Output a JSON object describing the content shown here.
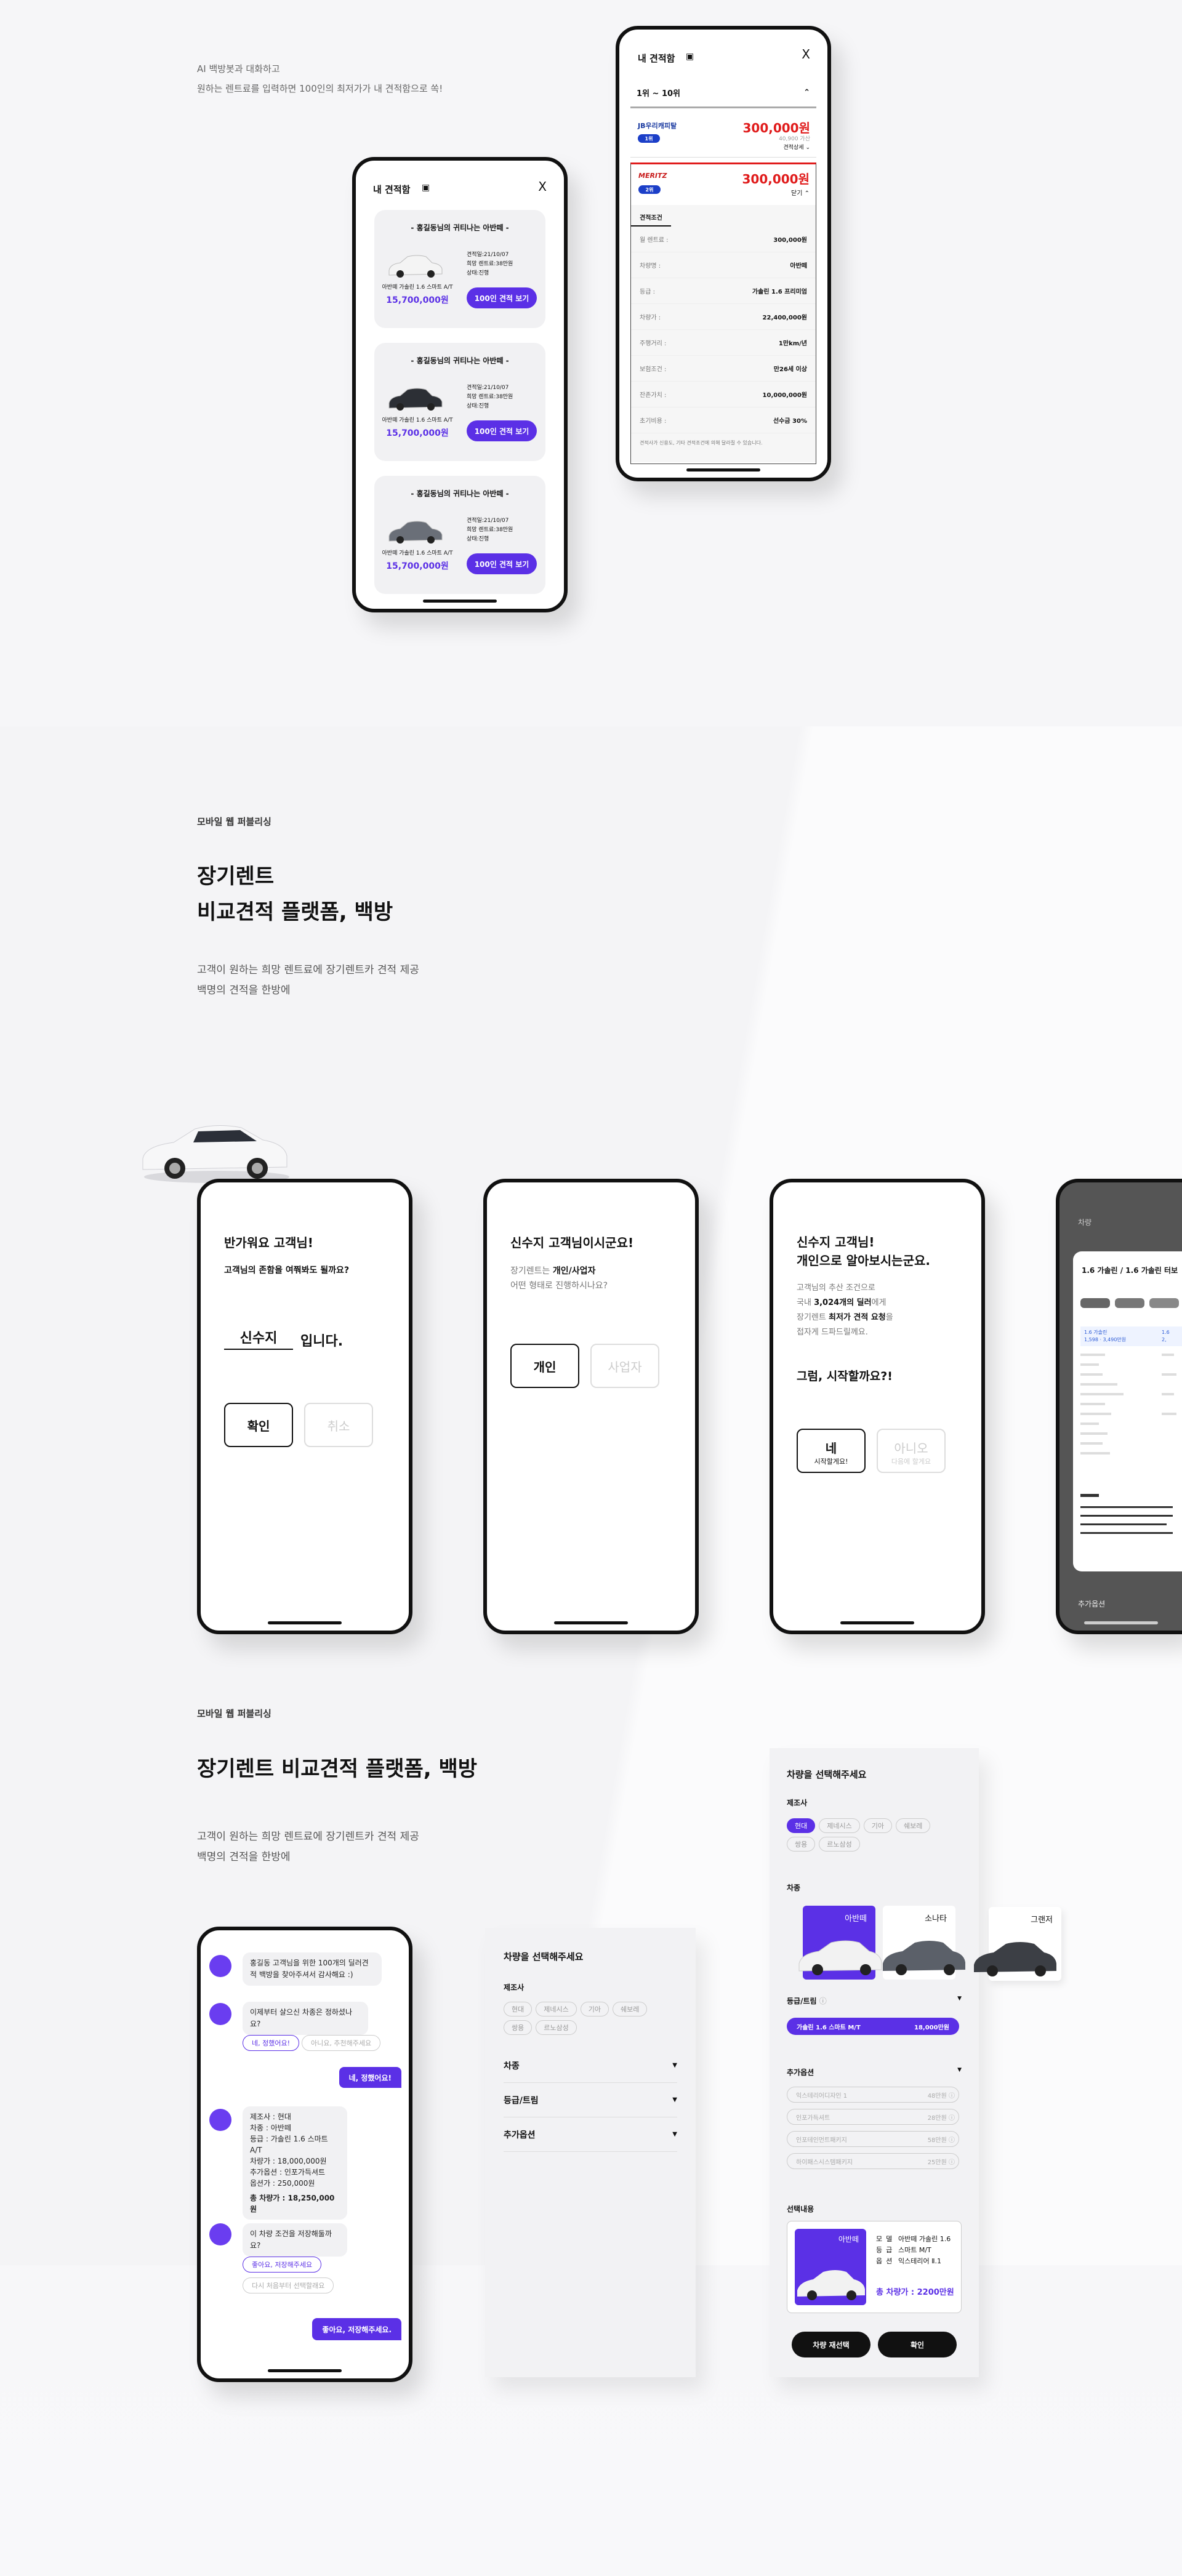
{
  "colors": {
    "accent": "#5b30e6",
    "red": "#e01b1b",
    "ink": "#111111"
  },
  "hero": {
    "line1": "AI 백방봇과 대화하고",
    "line2": "원하는 렌트료를 입력하면 100인의 최저가가 내 견적함으로 쏙!"
  },
  "box_phone": {
    "title": "내 견적함",
    "close": "X",
    "cards": [
      {
        "head": "- 홍길동님의 귀티나는 아반떼 -",
        "meta1": "견적일:21/10/07",
        "meta2": "희망 렌트료:38만원",
        "meta3": "상태:진행",
        "model": "아반떼 가솔린 1.6 스마트 A/T",
        "price": "15,700,000원",
        "btn": "100인 견적 보기"
      },
      {
        "head": "- 홍길동님의 귀티나는 아반떼 -",
        "meta1": "견적일:21/10/07",
        "meta2": "희망 렌트료:38만원",
        "meta3": "상태:진행",
        "model": "아반떼 가솔린 1.6 스마트 A/T",
        "price": "15,700,000원",
        "btn": "100인 견적 보기"
      },
      {
        "head": "- 홍길동님의 귀티나는 아반떼 -",
        "meta1": "견적일:21/10/07",
        "meta2": "희망 렌트료:38만원",
        "meta3": "상태:진행",
        "model": "아반떼 가솔린 1.6 스마트 A/T",
        "price": "15,700,000원",
        "btn": "100인 견적 보기"
      }
    ]
  },
  "rank_phone": {
    "title": "내 견적함",
    "close": "X",
    "range": "1위 ~ 10위",
    "q1": {
      "company": "JB우리캐피탈",
      "badge": "1위",
      "price": "300,000원",
      "sub": "40,900 가산",
      "more": "견적상세"
    },
    "q2": {
      "company": "MERITZ",
      "badge": "2위",
      "price": "300,000원",
      "more": "닫기"
    },
    "cond_title": "견적조건",
    "conds": [
      {
        "k": "월 렌트료 :",
        "v": "300,000원"
      },
      {
        "k": "차량명 :",
        "v": "아반떼"
      },
      {
        "k": "등급 :",
        "v": "가솔린 1.6 프리미엄"
      },
      {
        "k": "차량가 :",
        "v": "22,400,000원"
      },
      {
        "k": "주행거리 :",
        "v": "1만km/년"
      },
      {
        "k": "보험조건 :",
        "v": "만26세 이상"
      },
      {
        "k": "잔존가치 :",
        "v": "10,000,000원"
      },
      {
        "k": "초기비용 :",
        "v": "선수금 30%"
      }
    ],
    "note": "견적사가 신용도, 기타 견적조건에 의해 달라질 수 있습니다."
  },
  "sec1": {
    "label": "모바일 웹 퍼블리싱",
    "title1": "장기렌트",
    "title2": "비교견적 플랫폼, 백방",
    "desc1": "고객이 원하는 희망 렌트료에 장기렌트카 견적 제공",
    "desc2": "백명의 견적을 한방에"
  },
  "p1": {
    "title": "반가워요 고객님!",
    "q": "고객님의 존함을 여쭤봐도 될까요?",
    "name": "신수지",
    "suffix": "입니다.",
    "ok": "확인",
    "cancel": "취소"
  },
  "p2": {
    "title": "신수지 고객님이시군요!",
    "q1": "장기렌트는 ",
    "q1b": "개인/사업자",
    "q2": "어떤 형태로 진행하시나요?",
    "a": "개인",
    "b": "사업자"
  },
  "p3": {
    "t1": "신수지 고객님!",
    "t2": "개인으로 알아보시는군요.",
    "d1": "고객님의 추산 조건으로",
    "d2a": "국내 ",
    "d2b": "3,024개의 딜러",
    "d2c": "에게",
    "d3a": "장기렌트 ",
    "d3b": "최저가 견적 요청",
    "d3c": "을",
    "d4": "접자게 드파드릴께요.",
    "start": "그럼, 시작할까요?!",
    "yes": "네",
    "yes_sub": "시작할게요!",
    "no": "아니오",
    "no_sub": "다음에 할게요"
  },
  "p4": {
    "top": "차량",
    "popup_title": "1.6 가솔린 / 1.6 가솔린 터보",
    "extra": "추가옵션",
    "spec_l1": "1.6 가솔린",
    "spec_l2": "1,598 · 3,490만원",
    "spec_r1": "1.6",
    "spec_r2": "2,"
  },
  "sec2": {
    "label": "모바일 웹 퍼블리싱",
    "title": "장기렌트 비교견적 플랫폼, 백방",
    "desc1": "고객이 원하는 희망 렌트료에 장기렌트카 견적 제공",
    "desc2": "백명의 견적을 한방에"
  },
  "chat": {
    "m1": "홍길동 고객님을 위한 100개의 딜러견적 백방을 찾아주셔서 감사해요 :)",
    "m2": "이제부터 살으신 차종은 정하셨나요?",
    "o1": "네, 정했어요!",
    "o2": "아니요, 추천해주세요",
    "r1": "네, 정했어요!",
    "s1": "제조사 : 현대",
    "s2": "차종 : 아반떼",
    "s3": "등급 : 가솔린 1.6 스마트 A/T",
    "s4": "차량가 : 18,000,000원",
    "s5": "추가옵션 : 인포가득셔트",
    "s6": "옵션가 : 250,000원",
    "total": "총 차량가 : 18,250,000원",
    "m3": "이 차량 조건을 저장해둘까요?",
    "o3": "좋아요, 저장해주세요",
    "o4": "다시 처음부터 선택할래요",
    "r2": "좋아요, 저장해주세요."
  },
  "select_closed": {
    "title": "차량을 선택해주세요",
    "maker": "제조사",
    "chips": [
      "현대",
      "제네시스",
      "기아",
      "쉐보레",
      "쌍용",
      "르노삼성"
    ],
    "f1": "차종",
    "f2": "등급/트림",
    "f3": "추가옵션"
  },
  "select_open": {
    "title": "차량을 선택해주세요",
    "maker": "제조사",
    "chips": [
      "현대",
      "제네시스",
      "기아",
      "쉐보레",
      "쌍용",
      "르노삼성"
    ],
    "type": "차종",
    "cars": [
      "아반떼",
      "소나타",
      "그랜저"
    ],
    "grade": "등급/트림",
    "grade_sel": "가솔린 1.6 스마트 M/T",
    "grade_price": "18,000만원",
    "opt": "추가옵션",
    "opts": [
      {
        "n": "익스테리어디자인 1",
        "p": "48만원"
      },
      {
        "n": "인포가득셔트",
        "p": "28만원"
      },
      {
        "n": "인포테인먼트패키지",
        "p": "58만원"
      },
      {
        "n": "하이패스시스템패키지",
        "p": "25만원"
      }
    ],
    "result": "선택내용",
    "res_car": "아반떼",
    "res_l1": "모델",
    "res_v1": "아반떼 가솔린 1.6",
    "res_l2": "등급",
    "res_v2": "스마트 M/T",
    "res_l3": "옵션",
    "res_v3": "익스테리어 Ⅱ.1",
    "res_total": "총 차량가 : 2200만원",
    "btn1": "차량 재선택",
    "btn2": "확인"
  }
}
